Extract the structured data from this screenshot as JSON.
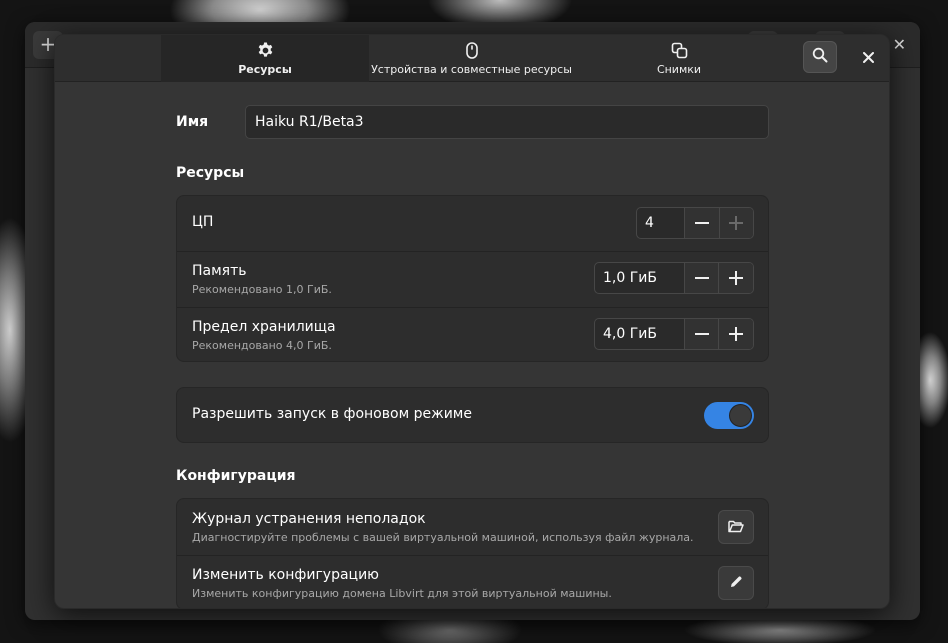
{
  "dialog": {
    "tabs": [
      {
        "label": "Ресурсы",
        "icon": "gear-icon",
        "active": true
      },
      {
        "label": "Устройства и совместные ресурсы",
        "icon": "mouse-icon",
        "active": false
      },
      {
        "label": "Снимки",
        "icon": "snapshots-icon",
        "active": false
      }
    ],
    "search_icon": "search-icon",
    "close_icon": "close-icon"
  },
  "name": {
    "label": "Имя",
    "value": "Haiku R1/Beta3"
  },
  "resources": {
    "title": "Ресурсы",
    "cpu": {
      "label": "ЦП",
      "value": "4",
      "minus_enabled": true,
      "plus_enabled": false
    },
    "memory": {
      "label": "Память",
      "subtitle": "Рекомендовано 1,0 ГиБ.",
      "value": "1,0 ГиБ"
    },
    "storage": {
      "label": "Предел хранилища",
      "subtitle": "Рекомендовано 4,0 ГиБ.",
      "value": "4,0 ГиБ"
    }
  },
  "background": {
    "label": "Разрешить запуск в фоновом режиме",
    "enabled": true
  },
  "configuration": {
    "title": "Конфигурация",
    "log": {
      "label": "Журнал устранения неполадок",
      "subtitle": "Диагностируйте проблемы с вашей виртуальной машиной, используя файл журнала.",
      "icon": "folder-open-icon"
    },
    "edit": {
      "label": "Изменить конфигурацию",
      "subtitle": "Изменить конфигурацию домена Libvirt для этой виртуальной машины.",
      "icon": "pencil-icon"
    }
  },
  "colors": {
    "accent": "#3584e4",
    "dialog_bg": "#353535",
    "card_bg": "#2d2d2d"
  }
}
